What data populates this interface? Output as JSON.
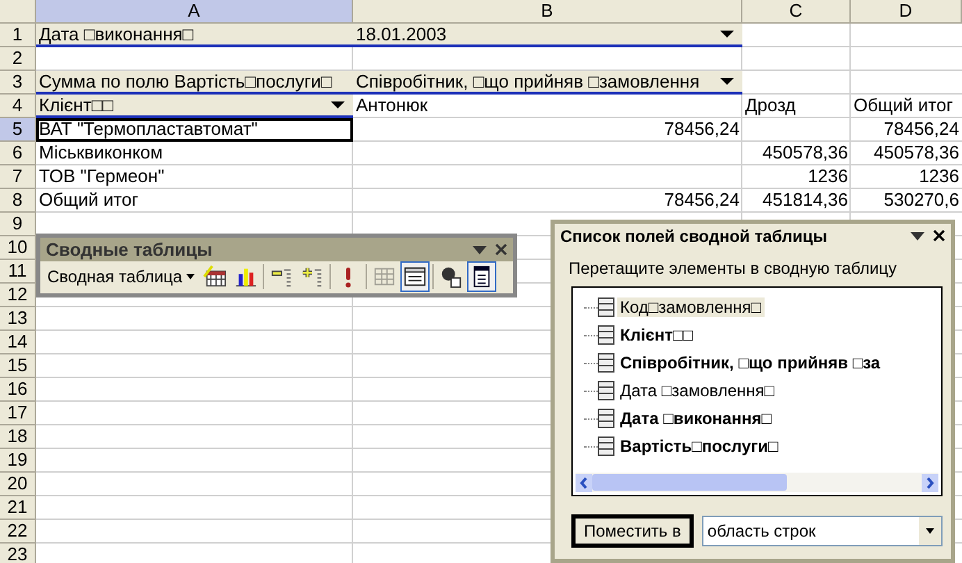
{
  "sheet": {
    "columns": [
      {
        "label": "A",
        "selected": true
      },
      {
        "label": "B",
        "selected": false
      },
      {
        "label": "C",
        "selected": false
      },
      {
        "label": "D",
        "selected": false
      }
    ],
    "rows": [
      {
        "number": "1",
        "selected": false,
        "cells": [
          {
            "kind": "field",
            "text": "Дата □виконання□"
          },
          {
            "kind": "dropfield",
            "text": "18.01.2003"
          },
          {
            "kind": "blank",
            "text": ""
          },
          {
            "kind": "blank",
            "text": ""
          }
        ]
      },
      {
        "number": "2",
        "selected": false,
        "cells": []
      },
      {
        "number": "3",
        "selected": false,
        "cells": [
          {
            "kind": "field",
            "text": "Сумма по полю Вартість□послуги□"
          },
          {
            "kind": "dropfield",
            "text": "Співробітник, □що прийняв □замовлення"
          }
        ]
      },
      {
        "number": "4",
        "selected": false,
        "cells": [
          {
            "kind": "dropfield",
            "text": "Клієнт□□"
          },
          {
            "kind": "text",
            "text": "Антонюк"
          },
          {
            "kind": "text",
            "text": "Дрозд"
          },
          {
            "kind": "text",
            "text": "Общий итог"
          }
        ]
      },
      {
        "number": "5",
        "selected": true,
        "cells": [
          {
            "kind": "active",
            "text": "ВАТ \"Термопластавтомат\""
          },
          {
            "kind": "number",
            "text": "78456,24"
          },
          {
            "kind": "number",
            "text": ""
          },
          {
            "kind": "number",
            "text": "78456,24"
          }
        ]
      },
      {
        "number": "6",
        "selected": false,
        "cells": [
          {
            "kind": "text",
            "text": "Міськвиконком"
          },
          {
            "kind": "number",
            "text": ""
          },
          {
            "kind": "number",
            "text": "450578,36"
          },
          {
            "kind": "number",
            "text": "450578,36"
          }
        ]
      },
      {
        "number": "7",
        "selected": false,
        "cells": [
          {
            "kind": "text",
            "text": "ТОВ \"Гермеон\""
          },
          {
            "kind": "number",
            "text": ""
          },
          {
            "kind": "number",
            "text": "1236"
          },
          {
            "kind": "number",
            "text": "1236"
          }
        ]
      },
      {
        "number": "8",
        "selected": false,
        "cells": [
          {
            "kind": "text",
            "text": "Общий итог"
          },
          {
            "kind": "number",
            "text": "78456,24"
          },
          {
            "kind": "number",
            "text": "451814,36"
          },
          {
            "kind": "number",
            "text": "530270,6"
          }
        ]
      },
      {
        "number": "9",
        "selected": false,
        "cells": []
      },
      {
        "number": "10",
        "selected": false,
        "cells": []
      },
      {
        "number": "11",
        "selected": false,
        "cells": []
      },
      {
        "number": "12",
        "selected": false,
        "cells": []
      },
      {
        "number": "13",
        "selected": false,
        "cells": []
      },
      {
        "number": "14",
        "selected": false,
        "cells": []
      },
      {
        "number": "15",
        "selected": false,
        "cells": []
      },
      {
        "number": "16",
        "selected": false,
        "cells": []
      },
      {
        "number": "17",
        "selected": false,
        "cells": []
      },
      {
        "number": "18",
        "selected": false,
        "cells": []
      },
      {
        "number": "19",
        "selected": false,
        "cells": []
      },
      {
        "number": "20",
        "selected": false,
        "cells": []
      },
      {
        "number": "21",
        "selected": false,
        "cells": []
      },
      {
        "number": "22",
        "selected": false,
        "cells": []
      },
      {
        "number": "23",
        "selected": false,
        "cells": []
      }
    ]
  },
  "pivot_toolbar": {
    "title": "Сводные таблицы",
    "menu": "Сводная таблица",
    "tools": [
      {
        "kind": "format",
        "pressed": false,
        "disabled": false
      },
      {
        "kind": "chart",
        "pressed": false,
        "disabled": false
      },
      {
        "kind": "hide",
        "pressed": false,
        "disabled": false
      },
      {
        "kind": "show",
        "pressed": false,
        "disabled": false
      },
      {
        "kind": "refresh",
        "pressed": false,
        "disabled": false
      },
      {
        "kind": "grid",
        "pressed": false,
        "disabled": true
      },
      {
        "kind": "fieldsettings",
        "pressed": true,
        "disabled": false
      },
      {
        "kind": "props",
        "pressed": false,
        "disabled": false
      },
      {
        "kind": "fieldlist",
        "pressed": true,
        "disabled": false
      }
    ]
  },
  "field_list": {
    "title": "Список полей сводной таблицы",
    "instruction": "Перетащите элементы в сводную таблицу",
    "fields": [
      {
        "text": "Код□замовлення□",
        "in_use": false,
        "selected": true
      },
      {
        "text": "Клієнт□□",
        "in_use": true,
        "selected": false
      },
      {
        "text": "Співробітник, □що прийняв □за",
        "in_use": true,
        "selected": false
      },
      {
        "text": "Дата □замовлення□",
        "in_use": false,
        "selected": false
      },
      {
        "text": "Дата □виконання□",
        "in_use": true,
        "selected": false
      },
      {
        "text": "Вартість□послуги□",
        "in_use": true,
        "selected": false
      }
    ],
    "button": "Поместить в",
    "area": "область строк"
  }
}
